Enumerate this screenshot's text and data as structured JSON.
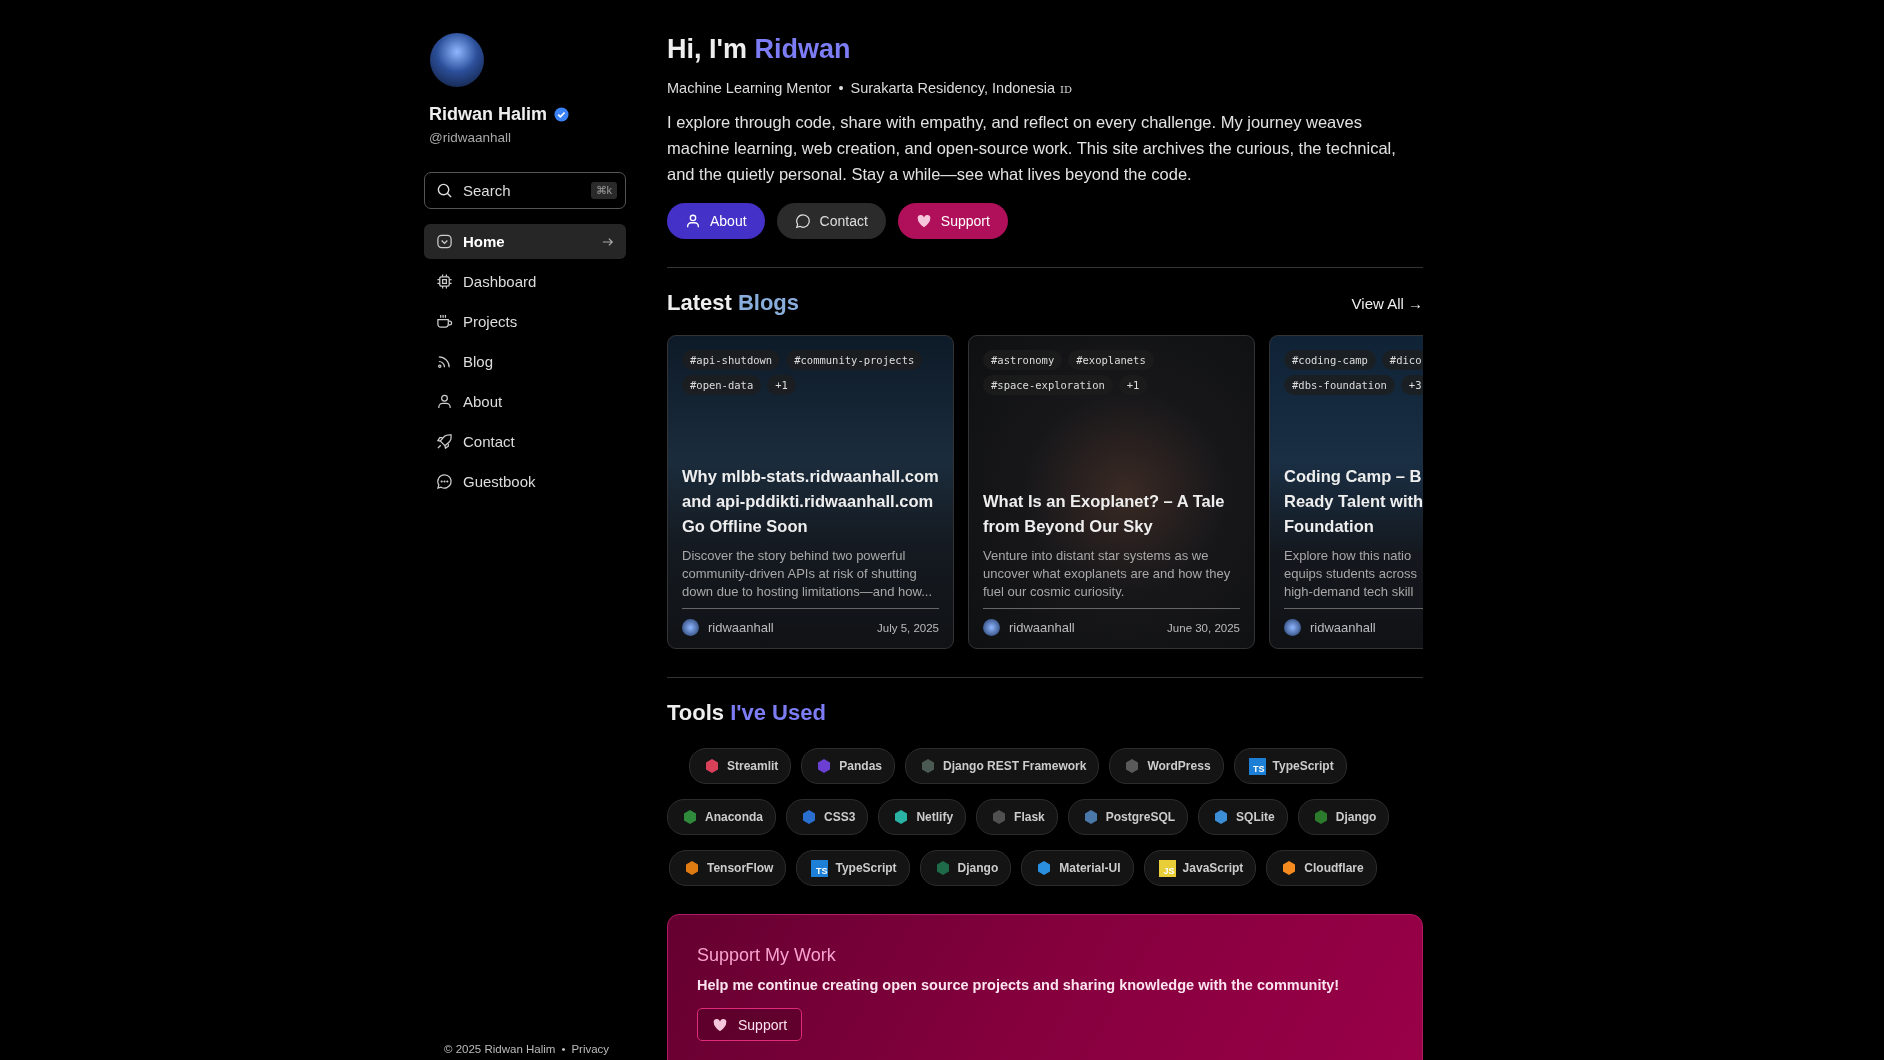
{
  "profile": {
    "name": "Ridwan Halim",
    "verified": true,
    "handle": "@ridwaanhall"
  },
  "search": {
    "placeholder": "Search",
    "shortcut": "⌘k"
  },
  "nav": [
    {
      "label": "Home",
      "kind": "home",
      "selected": true
    },
    {
      "label": "Dashboard",
      "kind": "chip",
      "selected": false
    },
    {
      "label": "Projects",
      "kind": "cup",
      "selected": false
    },
    {
      "label": "Blog",
      "kind": "rss",
      "selected": false
    },
    {
      "label": "About",
      "kind": "user",
      "selected": false
    },
    {
      "label": "Contact",
      "kind": "rocket",
      "selected": false
    },
    {
      "label": "Guestbook",
      "kind": "chat",
      "selected": false
    }
  ],
  "footer": {
    "copyright": "© 2025 Ridwan Halim",
    "separator": "•",
    "link": "Privacy"
  },
  "hero": {
    "greeting": "Hi, I'm",
    "highlight": "Ridwan",
    "role": "Machine Learning Mentor",
    "separator": "•",
    "location": "Surakarta Residency, Indonesia",
    "country_code": "ID",
    "bio": "I explore through code, share with empathy, and reflect on every challenge. My journey weaves machine learning, web creation, and open-source work. This site archives the curious, the technical, and the quietly personal. Stay a while—see what lives beyond the code.",
    "buttons": [
      {
        "label": "About",
        "kind": "primary"
      },
      {
        "label": "Contact",
        "kind": "secondary"
      },
      {
        "label": "Support",
        "kind": "support"
      }
    ]
  },
  "blogs": {
    "title": "Latest",
    "highlight": "Blogs",
    "view_all": "View All →",
    "cards": [
      {
        "tags": [
          "#api-shutdown",
          "#community-projects",
          "#open-data",
          "+1"
        ],
        "title": "Why mlbb-stats.ridwaanhall.com\nand api-pddikti.ridwaanhall.com\nGo Offline Soon",
        "excerpt": "Discover the story behind two powerful\ncommunity-driven APIs at risk of shutting\ndown due to hosting limitations—and how...",
        "author": "ridwaanhall",
        "date": "July 5, 2025"
      },
      {
        "tags": [
          "#astronomy",
          "#exoplanets",
          "#space-exploration",
          "+1"
        ],
        "title": "What Is an Exoplanet? – A Tale\nfrom Beyond Our Sky",
        "excerpt": "Venture into distant star systems as we\nuncover what exoplanets are and how they\nfuel our cosmic curiosity.",
        "author": "ridwaanhall",
        "date": "June 30, 2025"
      },
      {
        "tags": [
          "#coding-camp",
          "#dico",
          "#dbs-foundation",
          "+3"
        ],
        "title": "Coding Camp – B\nReady Talent with\nFoundation",
        "excerpt": "Explore how this natio\nequips students across\nhigh-demand tech skill",
        "author": "ridwaanhall"
      }
    ]
  },
  "tools": {
    "title": "Tools",
    "highlight": "I've Used",
    "rows": [
      {
        "chips": [
          {
            "label": "Streamlit",
            "kind": "mark",
            "color": "#d9415a"
          },
          {
            "label": "Pandas",
            "kind": "mark",
            "color": "#6b3fd1"
          },
          {
            "label": "Django REST Framework",
            "kind": "mark",
            "color": "#4a5a52"
          },
          {
            "label": "WordPress",
            "kind": "mark",
            "color": "#5a5a5a"
          },
          {
            "label": "TypeScript",
            "kind": "letters",
            "badge": "TS",
            "color": "#1e7fd6"
          }
        ]
      },
      {
        "chips": [
          {
            "label": "Anaconda",
            "kind": "mark",
            "color": "#2f8a3c"
          },
          {
            "label": "CSS3",
            "kind": "mark",
            "color": "#2a6fd0"
          },
          {
            "label": "Netlify",
            "kind": "mark",
            "color": "#2ab3a4"
          },
          {
            "label": "Flask",
            "kind": "mark",
            "color": "#505050"
          },
          {
            "label": "PostgreSQL",
            "kind": "mark",
            "color": "#4a78a8"
          },
          {
            "label": "SQLite",
            "kind": "mark",
            "color": "#3c8fd6"
          },
          {
            "label": "Django",
            "kind": "mark",
            "color": "#2c7a2c"
          }
        ]
      },
      {
        "chips": [
          {
            "label": "TensorFlow",
            "kind": "mark",
            "color": "#e07b12"
          },
          {
            "label": "TypeScript",
            "kind": "letters",
            "badge": "TS",
            "color": "#1e7fd6"
          },
          {
            "label": "Django",
            "kind": "mark",
            "color": "#1f6a48"
          },
          {
            "label": "Material-UI",
            "kind": "mark",
            "color": "#2b8fe0"
          },
          {
            "label": "JavaScript",
            "kind": "letters",
            "badge": "JS",
            "color": "#e8cf3a"
          },
          {
            "label": "Cloudflare",
            "kind": "mark",
            "color": "#f58a1f"
          }
        ]
      }
    ]
  },
  "support": {
    "title": "Support My Work",
    "text": "Help me continue creating open source projects and sharing knowledge with the community!",
    "button": "Support"
  }
}
